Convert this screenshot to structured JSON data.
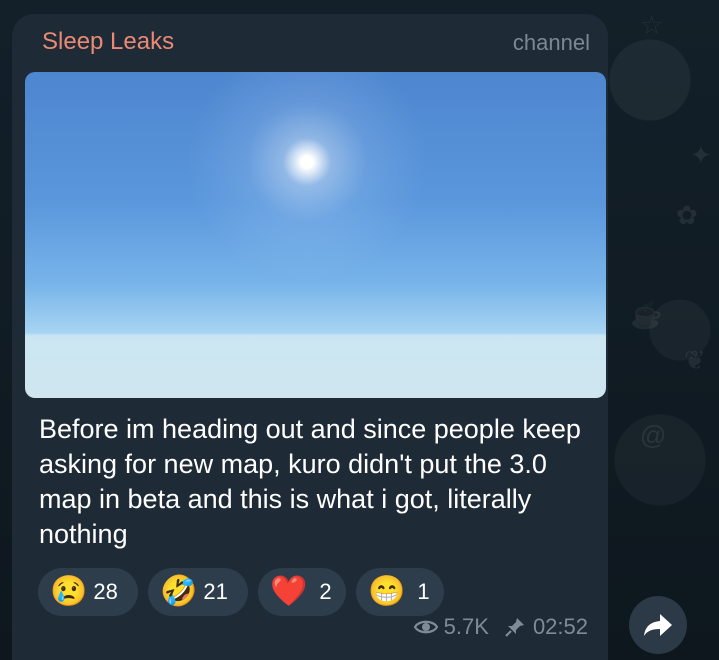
{
  "message": {
    "channel_name": "Sleep Leaks",
    "channel_tag": "channel",
    "caption": "Before im heading out and since people keep asking for new map, kuro didn't put the 3.0 map in beta and this is what i got, literally nothing",
    "reactions": [
      {
        "emoji": "😢",
        "count": "28"
      },
      {
        "emoji": "🤣",
        "count": "21"
      },
      {
        "emoji": "❤️",
        "count": "2"
      },
      {
        "emoji": "😁",
        "count": "1"
      }
    ],
    "views": "5.7K",
    "time": "02:52"
  },
  "icons": {
    "views": "eye-icon",
    "pin": "pin-icon",
    "share": "share-arrow-icon"
  },
  "colors": {
    "channel_name": "#e88a75",
    "bubble": "#1e2a35",
    "reaction_pill": "#2d3d4c",
    "meta_text": "#7f8b97"
  }
}
